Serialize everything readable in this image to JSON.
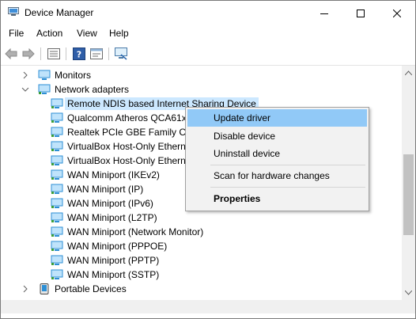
{
  "window": {
    "title": "Device Manager"
  },
  "menubar": {
    "items": [
      "File",
      "Action",
      "View",
      "Help"
    ]
  },
  "toolbar": {
    "buttons": [
      "back-icon",
      "forward-icon",
      "properties-icon",
      "help-icon",
      "show-hidden-icon",
      "scan-hardware-icon"
    ]
  },
  "tree": {
    "monitors": "Monitors",
    "network_adapters": "Network adapters",
    "devices": [
      "Remote NDIS based Internet Sharing Device",
      "Qualcomm Atheros QCA61x",
      "Realtek PCIe GBE Family Cor",
      "VirtualBox Host-Only Ethern",
      "VirtualBox Host-Only Ethern",
      "WAN Miniport (IKEv2)",
      "WAN Miniport (IP)",
      "WAN Miniport (IPv6)",
      "WAN Miniport (L2TP)",
      "WAN Miniport (Network Monitor)",
      "WAN Miniport (PPPOE)",
      "WAN Miniport (PPTP)",
      "WAN Miniport (SSTP)"
    ],
    "portable_devices": "Portable Devices"
  },
  "context_menu": {
    "update_driver": "Update driver",
    "disable_device": "Disable device",
    "uninstall_device": "Uninstall device",
    "scan_hardware": "Scan for hardware changes",
    "properties": "Properties"
  },
  "colors": {
    "selection": "#cce8ff",
    "menu_hover": "#91c9f7",
    "adapter_icon": "#2d8fd5"
  }
}
